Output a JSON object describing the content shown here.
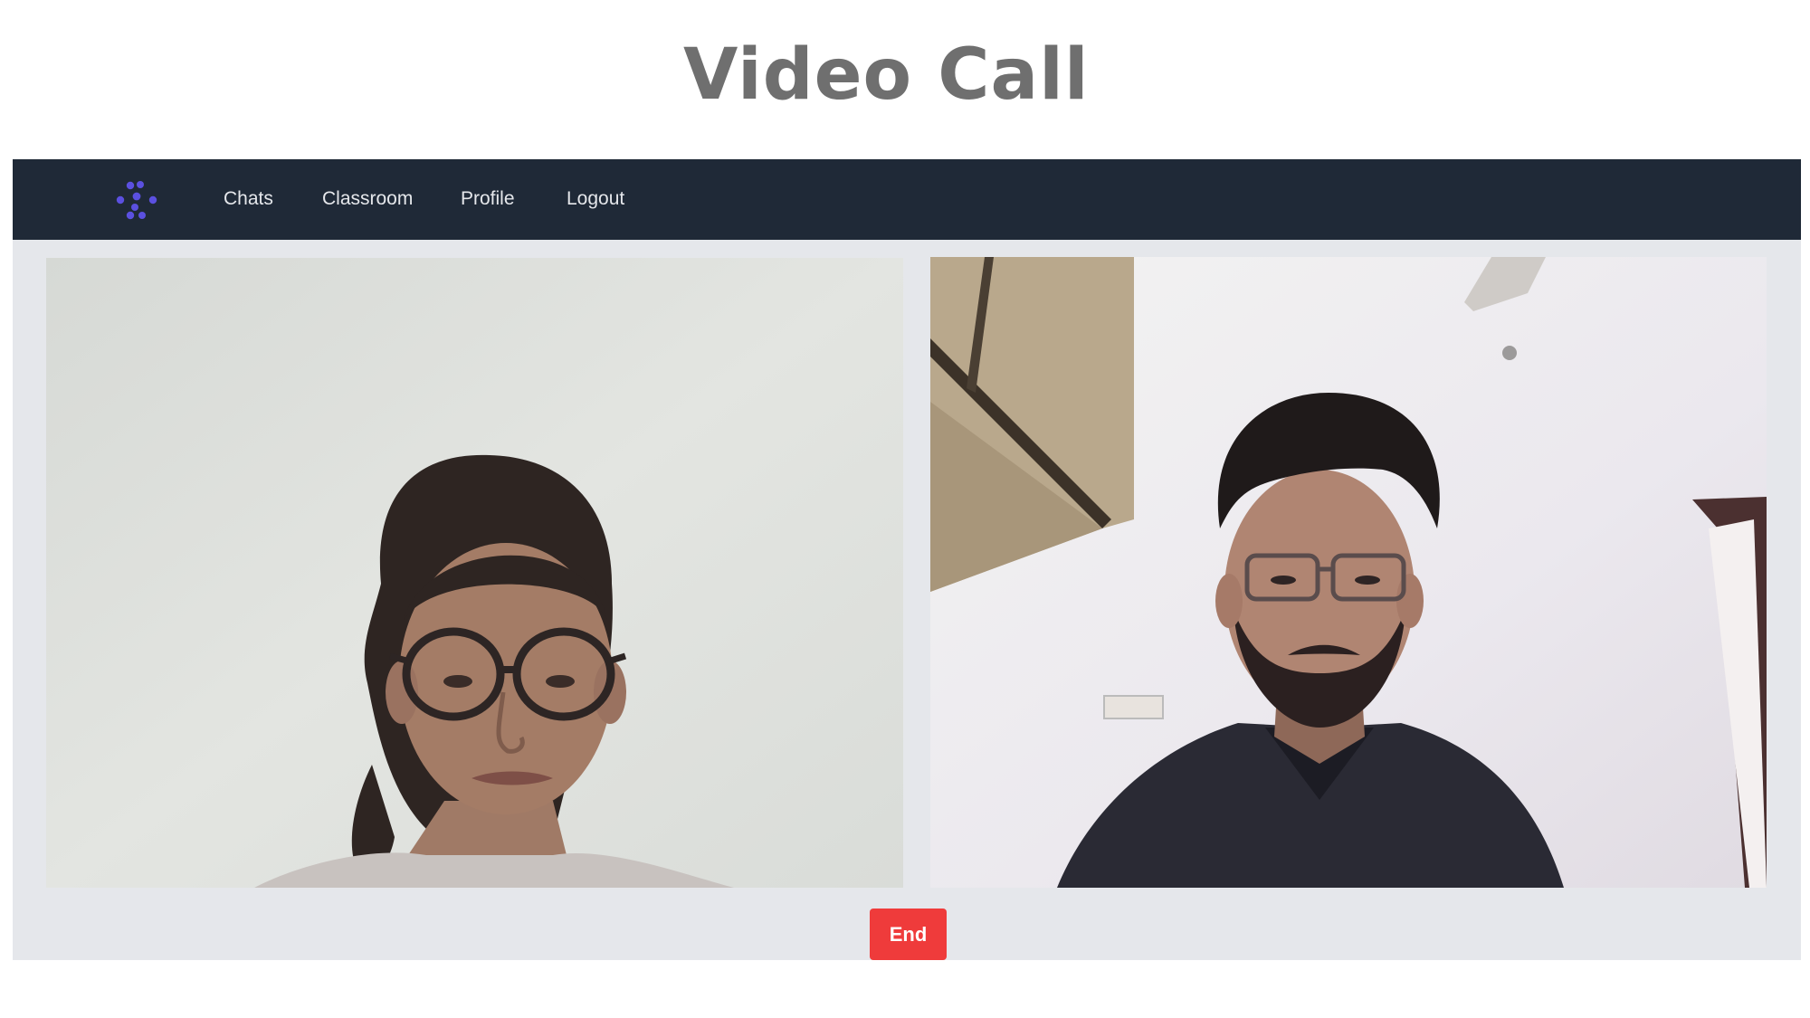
{
  "page": {
    "title": "Video Call"
  },
  "navbar": {
    "logo_icon": "dots-burst-logo-icon",
    "links": [
      {
        "label": "Chats"
      },
      {
        "label": "Classroom"
      },
      {
        "label": "Profile"
      },
      {
        "label": "Logout"
      }
    ]
  },
  "videos": {
    "local": {
      "name": "local-video"
    },
    "remote": {
      "name": "remote-video"
    }
  },
  "controls": {
    "end_label": "End"
  },
  "colors": {
    "navbar_bg": "#1f2937",
    "frame_bg": "#e5e7eb",
    "logo_accent": "#5b50e0",
    "end_button": "#ef3b3b",
    "title_text": "#6f6f6f"
  }
}
